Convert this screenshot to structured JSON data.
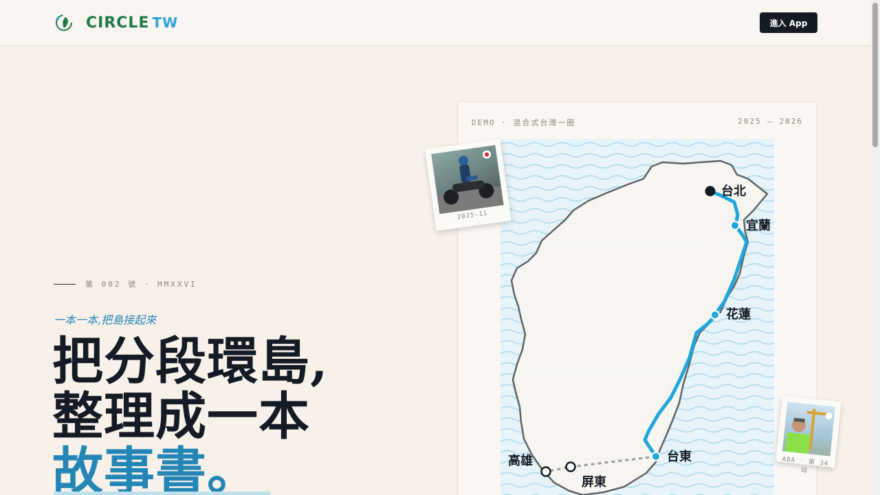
{
  "header": {
    "logo_main": "CIRCLE",
    "logo_suffix": "TW",
    "enter_button": "進入 App"
  },
  "hero": {
    "issue_label": "第 002 號 · MMXXVI",
    "tagline": "一本一本,把島接起來",
    "headline_line1": "把分段環島,",
    "headline_line2": "整理成一本",
    "headline_line3": "故事書。"
  },
  "demo_card": {
    "left_label": "DEMO · 混合式台灣一圈",
    "right_label": "2025 — 2026"
  },
  "map": {
    "cities": [
      {
        "name": "台北",
        "type": "start"
      },
      {
        "name": "宜蘭",
        "type": "visited"
      },
      {
        "name": "花蓮",
        "type": "visited"
      },
      {
        "name": "台東",
        "type": "visited"
      },
      {
        "name": "屏東",
        "type": "planned"
      },
      {
        "name": "高雄",
        "type": "planned"
      }
    ],
    "route_color": "#1fa6dc",
    "planned_color": "#9a9a9a"
  },
  "photos": [
    {
      "caption": "2025-11",
      "subject": "motorcycle-rider"
    },
    {
      "caption": "ABA · 第 34 站",
      "subject": "cyclist-selfie"
    }
  ],
  "colors": {
    "background": "#f7f1ea",
    "accent": "#2486b6",
    "brand_green": "#1d7a45",
    "brand_blue": "#2aa3d8",
    "dark": "#151b24"
  }
}
